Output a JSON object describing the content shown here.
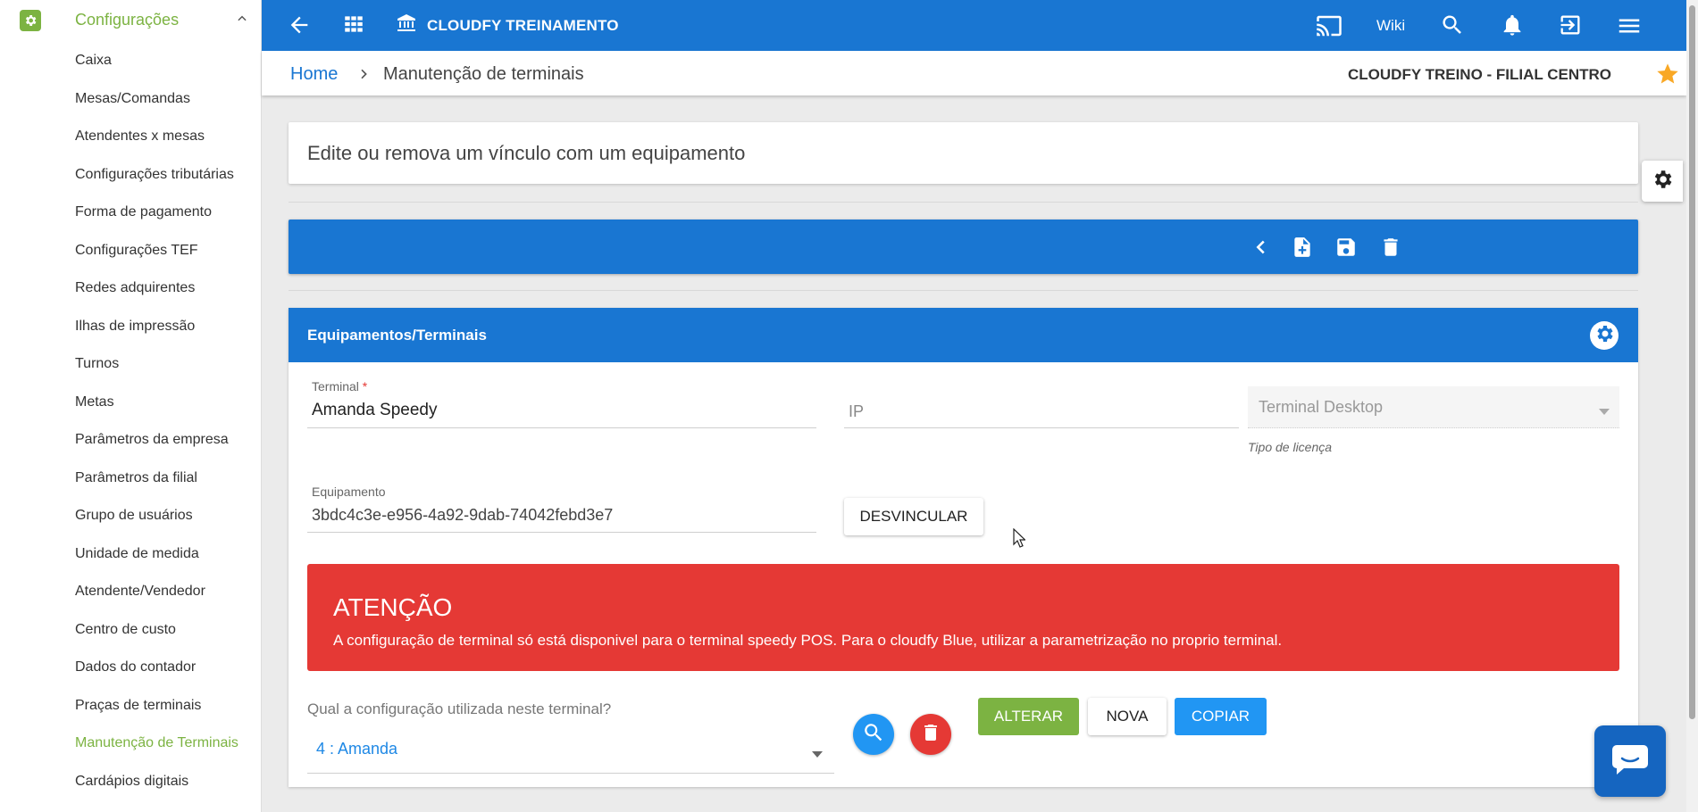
{
  "sidebar": {
    "section_title": "Configurações",
    "items": [
      {
        "label": "Caixa"
      },
      {
        "label": "Mesas/Comandas"
      },
      {
        "label": "Atendentes x mesas"
      },
      {
        "label": "Configurações tributárias"
      },
      {
        "label": "Forma de pagamento"
      },
      {
        "label": "Configurações TEF"
      },
      {
        "label": "Redes adquirentes"
      },
      {
        "label": "Ilhas de impressão"
      },
      {
        "label": "Turnos"
      },
      {
        "label": "Metas"
      },
      {
        "label": "Parâmetros da empresa"
      },
      {
        "label": "Parâmetros da filial"
      },
      {
        "label": "Grupo de usuários"
      },
      {
        "label": "Unidade de medida"
      },
      {
        "label": "Atendente/Vendedor"
      },
      {
        "label": "Centro de custo"
      },
      {
        "label": "Dados do contador"
      },
      {
        "label": "Praças de terminais"
      },
      {
        "label": "Manutenção de Terminais"
      },
      {
        "label": "Cardápios digitais"
      }
    ],
    "active_index": 18
  },
  "topbar": {
    "title": "CLOUDFY TREINAMENTO",
    "wiki_label": "Wiki",
    "icons": [
      "back-arrow-icon",
      "apps-grid-icon",
      "bank-icon",
      "cast-icon",
      "search-icon",
      "bell-icon",
      "logout-icon",
      "menu-icon"
    ]
  },
  "breadcrumb": {
    "home": "Home",
    "current": "Manutenção de terminais",
    "branch": "CLOUDFY TREINO - FILIAL CENTRO"
  },
  "page": {
    "subtitle": "Edite ou remova um vínculo com um equipamento"
  },
  "panel": {
    "title": "Equipamentos/Terminais",
    "terminal_label": "Terminal",
    "terminal_required": "*",
    "terminal_value": "Amanda Speedy",
    "ip_placeholder": "IP",
    "license_value": "Terminal Desktop",
    "license_hint": "Tipo de licença",
    "equipment_label": "Equipamento",
    "equipment_value": "3bdc4c3e-e956-4a92-9dab-74042febd3e7",
    "unlink_label": "DESVINCULAR",
    "alert_title": "ATENÇÃO",
    "alert_text": "A configuração de terminal só está disponivel para o terminal speedy POS. Para o cloudfy Blue, utilizar a parametrização no proprio terminal.",
    "config_label": "Qual a configuração utilizada neste terminal?",
    "config_value": "4 : Amanda",
    "alter_label": "ALTERAR",
    "new_label": "NOVA",
    "copy_label": "COPIAR"
  },
  "colors": {
    "primary": "#1976d2",
    "accent_green": "#7cb342",
    "alert_red": "#e53935",
    "copy_blue": "#2196f3",
    "star": "#f9a825"
  }
}
